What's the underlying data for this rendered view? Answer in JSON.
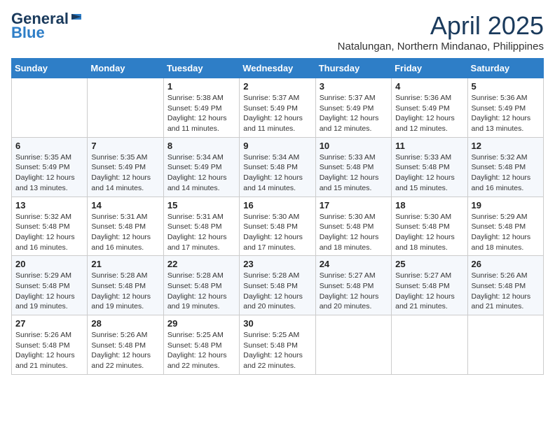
{
  "logo": {
    "general": "General",
    "blue": "Blue"
  },
  "title": "April 2025",
  "subtitle": "Natalungan, Northern Mindanao, Philippines",
  "days_of_week": [
    "Sunday",
    "Monday",
    "Tuesday",
    "Wednesday",
    "Thursday",
    "Friday",
    "Saturday"
  ],
  "weeks": [
    [
      null,
      null,
      {
        "day": 1,
        "sunrise": "5:38 AM",
        "sunset": "5:49 PM",
        "daylight": "12 hours and 11 minutes."
      },
      {
        "day": 2,
        "sunrise": "5:37 AM",
        "sunset": "5:49 PM",
        "daylight": "12 hours and 11 minutes."
      },
      {
        "day": 3,
        "sunrise": "5:37 AM",
        "sunset": "5:49 PM",
        "daylight": "12 hours and 12 minutes."
      },
      {
        "day": 4,
        "sunrise": "5:36 AM",
        "sunset": "5:49 PM",
        "daylight": "12 hours and 12 minutes."
      },
      {
        "day": 5,
        "sunrise": "5:36 AM",
        "sunset": "5:49 PM",
        "daylight": "12 hours and 13 minutes."
      }
    ],
    [
      {
        "day": 6,
        "sunrise": "5:35 AM",
        "sunset": "5:49 PM",
        "daylight": "12 hours and 13 minutes."
      },
      {
        "day": 7,
        "sunrise": "5:35 AM",
        "sunset": "5:49 PM",
        "daylight": "12 hours and 14 minutes."
      },
      {
        "day": 8,
        "sunrise": "5:34 AM",
        "sunset": "5:49 PM",
        "daylight": "12 hours and 14 minutes."
      },
      {
        "day": 9,
        "sunrise": "5:34 AM",
        "sunset": "5:48 PM",
        "daylight": "12 hours and 14 minutes."
      },
      {
        "day": 10,
        "sunrise": "5:33 AM",
        "sunset": "5:48 PM",
        "daylight": "12 hours and 15 minutes."
      },
      {
        "day": 11,
        "sunrise": "5:33 AM",
        "sunset": "5:48 PM",
        "daylight": "12 hours and 15 minutes."
      },
      {
        "day": 12,
        "sunrise": "5:32 AM",
        "sunset": "5:48 PM",
        "daylight": "12 hours and 16 minutes."
      }
    ],
    [
      {
        "day": 13,
        "sunrise": "5:32 AM",
        "sunset": "5:48 PM",
        "daylight": "12 hours and 16 minutes."
      },
      {
        "day": 14,
        "sunrise": "5:31 AM",
        "sunset": "5:48 PM",
        "daylight": "12 hours and 16 minutes."
      },
      {
        "day": 15,
        "sunrise": "5:31 AM",
        "sunset": "5:48 PM",
        "daylight": "12 hours and 17 minutes."
      },
      {
        "day": 16,
        "sunrise": "5:30 AM",
        "sunset": "5:48 PM",
        "daylight": "12 hours and 17 minutes."
      },
      {
        "day": 17,
        "sunrise": "5:30 AM",
        "sunset": "5:48 PM",
        "daylight": "12 hours and 18 minutes."
      },
      {
        "day": 18,
        "sunrise": "5:30 AM",
        "sunset": "5:48 PM",
        "daylight": "12 hours and 18 minutes."
      },
      {
        "day": 19,
        "sunrise": "5:29 AM",
        "sunset": "5:48 PM",
        "daylight": "12 hours and 18 minutes."
      }
    ],
    [
      {
        "day": 20,
        "sunrise": "5:29 AM",
        "sunset": "5:48 PM",
        "daylight": "12 hours and 19 minutes."
      },
      {
        "day": 21,
        "sunrise": "5:28 AM",
        "sunset": "5:48 PM",
        "daylight": "12 hours and 19 minutes."
      },
      {
        "day": 22,
        "sunrise": "5:28 AM",
        "sunset": "5:48 PM",
        "daylight": "12 hours and 19 minutes."
      },
      {
        "day": 23,
        "sunrise": "5:28 AM",
        "sunset": "5:48 PM",
        "daylight": "12 hours and 20 minutes."
      },
      {
        "day": 24,
        "sunrise": "5:27 AM",
        "sunset": "5:48 PM",
        "daylight": "12 hours and 20 minutes."
      },
      {
        "day": 25,
        "sunrise": "5:27 AM",
        "sunset": "5:48 PM",
        "daylight": "12 hours and 21 minutes."
      },
      {
        "day": 26,
        "sunrise": "5:26 AM",
        "sunset": "5:48 PM",
        "daylight": "12 hours and 21 minutes."
      }
    ],
    [
      {
        "day": 27,
        "sunrise": "5:26 AM",
        "sunset": "5:48 PM",
        "daylight": "12 hours and 21 minutes."
      },
      {
        "day": 28,
        "sunrise": "5:26 AM",
        "sunset": "5:48 PM",
        "daylight": "12 hours and 22 minutes."
      },
      {
        "day": 29,
        "sunrise": "5:25 AM",
        "sunset": "5:48 PM",
        "daylight": "12 hours and 22 minutes."
      },
      {
        "day": 30,
        "sunrise": "5:25 AM",
        "sunset": "5:48 PM",
        "daylight": "12 hours and 22 minutes."
      },
      null,
      null,
      null
    ]
  ]
}
